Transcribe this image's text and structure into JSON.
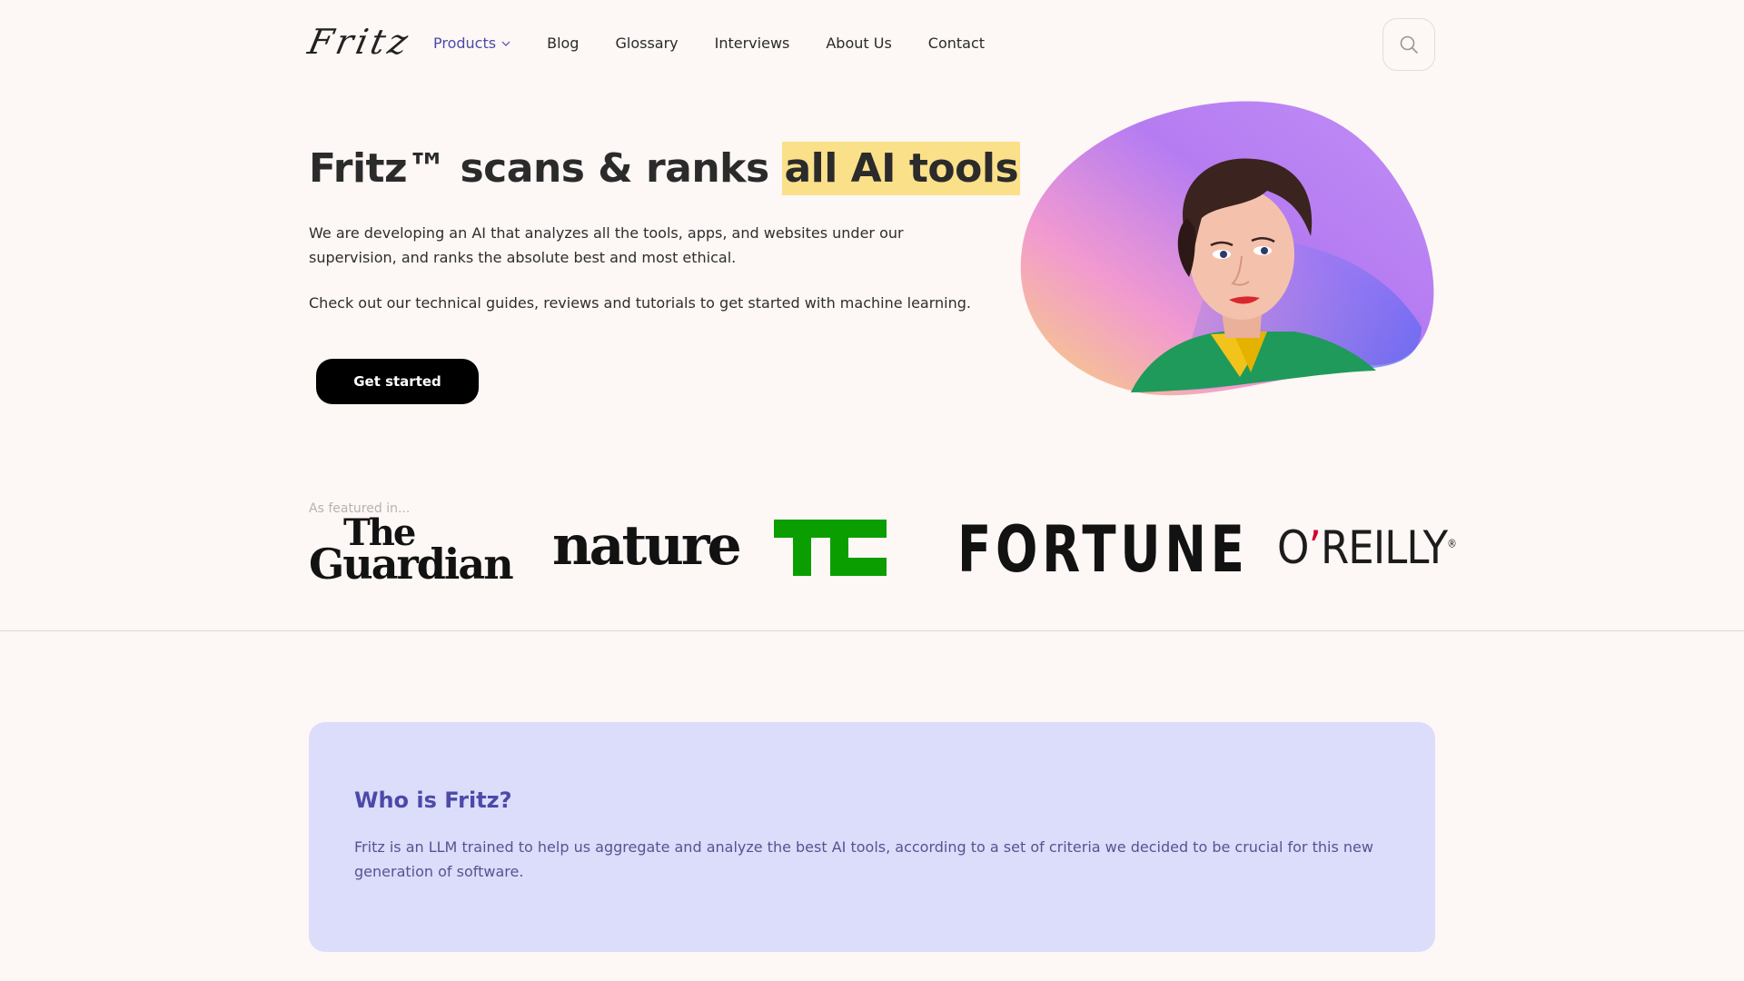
{
  "header": {
    "logo": "Fritz",
    "nav": [
      {
        "label": "Products"
      },
      {
        "label": "Blog"
      },
      {
        "label": "Glossary"
      },
      {
        "label": "Interviews"
      },
      {
        "label": "About Us"
      },
      {
        "label": "Contact"
      }
    ],
    "search_icon": "search-icon"
  },
  "hero": {
    "title_prefix": "Fritz™ scans & ranks ",
    "title_highlight": "all AI tools",
    "paragraph1": "We are developing an AI that analyzes all the tools, apps, and websites under our supervision, and ranks the absolute best and most ethical.",
    "paragraph2": "Check out our technical guides, reviews and tutorials to get started with machine learning.",
    "cta_label": "Get started",
    "highlight_color": "#fbe08a"
  },
  "featured": {
    "label": "As featured in...",
    "guardian_the": "The",
    "guardian_name": "Guardian",
    "nature": "nature",
    "tc_color": "#0a9e01",
    "fortune": "FORTUNE",
    "oreilly": {
      "o": "O",
      "apos": "’",
      "rest": "REILLY",
      "reg": "®"
    }
  },
  "about": {
    "title": "Who is Fritz?",
    "text": "Fritz is an LLM trained to help us aggregate and analyze the best AI tools, according to a set of criteria we decided to be crucial for this new generation of software."
  },
  "colors": {
    "background": "#fdf7f5",
    "accent": "#4b4aa8",
    "card_background": "#dcdcfb"
  }
}
